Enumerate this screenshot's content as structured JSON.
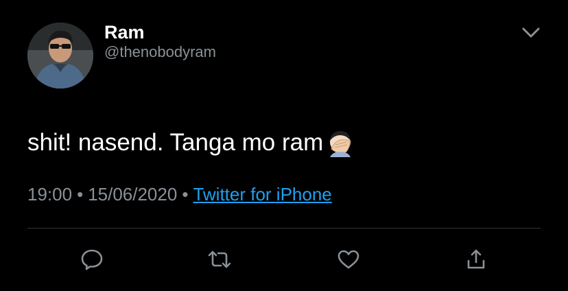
{
  "tweet": {
    "display_name": "Ram",
    "handle": "@thenobodyram",
    "text": "shit! nasend. Tanga mo ram",
    "emoji": "face-palm-emoji",
    "time": "19:00",
    "separator": "•",
    "date": "15/06/2020",
    "source": "Twitter for iPhone"
  },
  "theme": {
    "background": "#000000",
    "primary_text": "#ffffff",
    "secondary_text": "#8a9197",
    "link": "#1da1f2",
    "divider": "#2f3336",
    "icon": "#8a9197"
  },
  "actions": [
    {
      "name": "reply",
      "icon": "speech-bubble-icon"
    },
    {
      "name": "retweet",
      "icon": "retweet-arrows-icon"
    },
    {
      "name": "like",
      "icon": "heart-icon"
    },
    {
      "name": "share",
      "icon": "share-upload-icon"
    }
  ],
  "menu": {
    "icon": "chevron-down-icon"
  }
}
